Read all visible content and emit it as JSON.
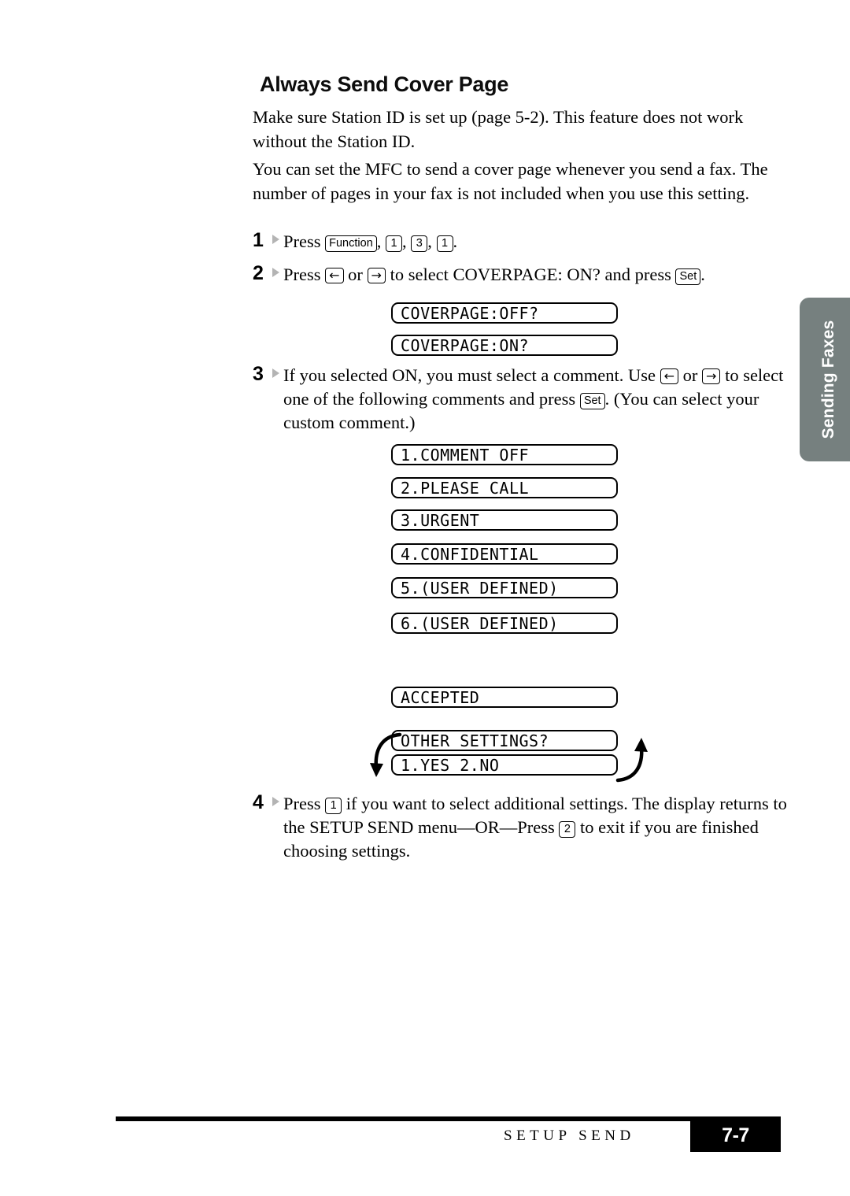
{
  "heading": "Always Send Cover Page",
  "paragraphs": {
    "intro_1": "Make sure Station ID is set up (page 5-2). This feature does not work without the Station ID.",
    "intro_2": "You can set the MFC to send a cover page whenever you send a fax. The number of pages in your fax is not included when you use this setting."
  },
  "steps": {
    "one": {
      "number": "1",
      "press_label": "Press",
      "keys": {
        "function": "Function",
        "digit_1": "1",
        "digit_3": "3",
        "digit_1b": "1"
      },
      "comma": ",",
      "period": "."
    },
    "two": {
      "number": "2",
      "text_before": "Press",
      "key_left": "←",
      "text_or": "or",
      "key_right": "→",
      "text_middle": "to select COVERPAGE: ON? and press",
      "key_set": "Set",
      "text_end": "."
    },
    "three": {
      "number": "3",
      "text_part_1": "If you selected ON, you must select a comment. Use",
      "key_left": "←",
      "text_or": "or",
      "key_right": "→",
      "text_part_2": "to select one of the following comments and press",
      "key_set": "Set",
      "text_part_3": ".  (You can select your custom comment.)"
    },
    "four": {
      "number": "4",
      "text_part_1": "Press",
      "key_1": "1",
      "text_part_2": "if you want to select additional settings. The display returns to the SETUP SEND menu—OR—Press",
      "key_2": "2",
      "text_part_3": "to exit if you are finished choosing settings."
    }
  },
  "lcd_displays": {
    "coverpage_off": "COVERPAGE:OFF?",
    "coverpage_on": "COVERPAGE:ON?",
    "comment_1": "1.COMMENT OFF",
    "comment_2": "2.PLEASE CALL",
    "comment_3": "3.URGENT",
    "comment_4": "4.CONFIDENTIAL",
    "comment_5": "5.(USER DEFINED)",
    "comment_6": "6.(USER DEFINED)",
    "accepted": "ACCEPTED",
    "other_settings": "OTHER SETTINGS?",
    "yes_no": "1.YES 2.NO"
  },
  "side_tab": {
    "label": "Sending Faxes",
    "color": "#76807f"
  },
  "footer": {
    "section_label": "SETUP SEND",
    "page_number": "7-7"
  }
}
